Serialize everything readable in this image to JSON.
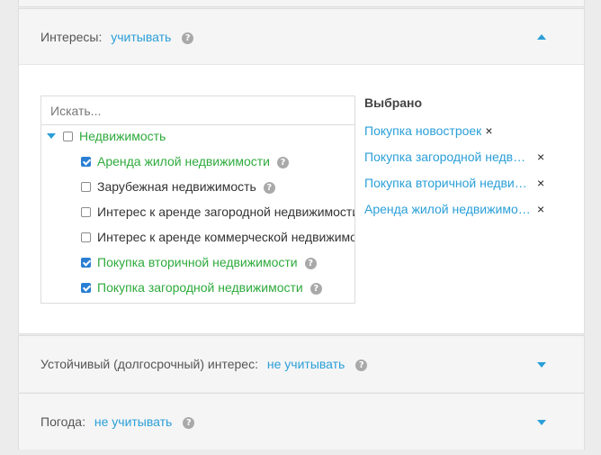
{
  "interests": {
    "label": "Интересы:",
    "value": "учитывать",
    "help": "?",
    "search_placeholder": "Искать...",
    "tree": {
      "root": "Недвижимость",
      "items": [
        {
          "label": "Аренда жилой недвижимости",
          "checked": true
        },
        {
          "label": "Зарубежная недвижимость",
          "checked": false
        },
        {
          "label": "Интерес к аренде загородной недвижимости",
          "checked": false
        },
        {
          "label": "Интерес к аренде коммерческой недвижимости",
          "checked": false
        },
        {
          "label": "Покупка вторичной недвижимости",
          "checked": true
        },
        {
          "label": "Покупка загородной недвижимости",
          "checked": true
        }
      ]
    },
    "selected_title": "Выбрано",
    "selected": [
      "Покупка новостроек",
      "Покупка загородной недвижимости",
      "Покупка вторичной недвижимости",
      "Аренда жилой недвижимости"
    ],
    "remove_glyph": "×"
  },
  "longterm": {
    "label": "Устойчивый (долгосрочный) интерес:",
    "value": "не учитывать",
    "help": "?"
  },
  "weather": {
    "label": "Погода:",
    "value": "не учитывать",
    "help": "?"
  }
}
